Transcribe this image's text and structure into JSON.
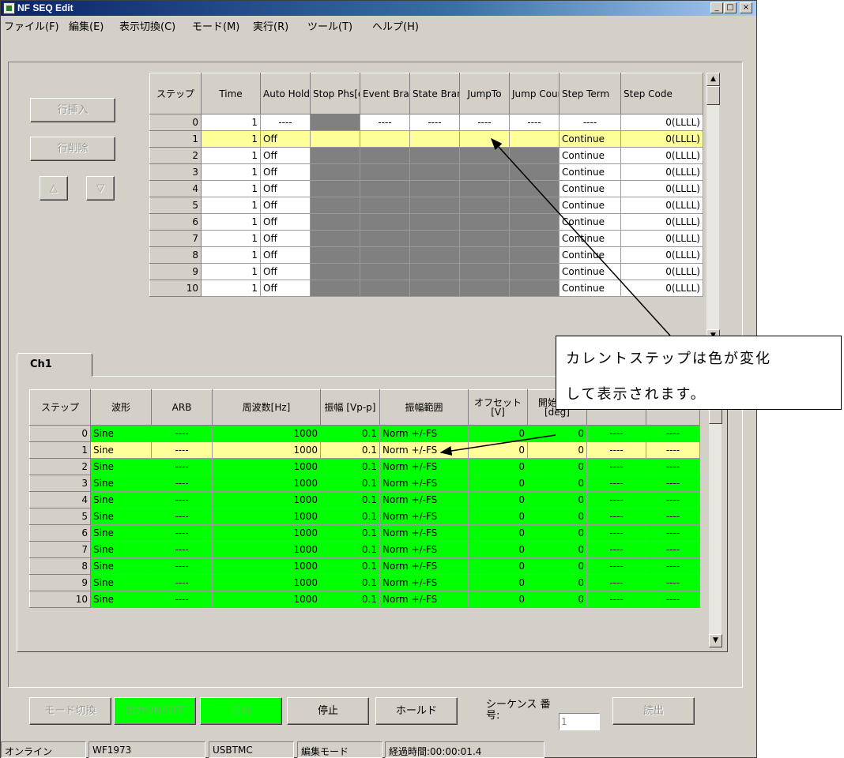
{
  "window": {
    "title": "NF SEQ Edit",
    "min": "_",
    "max": "□",
    "close": "×"
  },
  "menu": [
    "ファイル(F)",
    "編集(E)",
    "表示切換(C)",
    "モード(M)",
    "実行(R)",
    "ツール(T)",
    "ヘルプ(H)"
  ],
  "side_buttons": {
    "insert_row": "行挿入",
    "delete_row": "行削除",
    "up": "△",
    "down": "▽"
  },
  "step_table": {
    "headers": [
      "ステップ",
      "Time",
      "Auto Hold",
      "Stop Phs[deg]",
      "Event Branch",
      "State Branch",
      "JumpTo",
      "Jump Count",
      "Step Term",
      "Step Code"
    ],
    "rows": [
      [
        "0",
        "1",
        "----",
        "",
        "----",
        "----",
        "----",
        "----",
        "----",
        "0(LLLL)"
      ],
      [
        "1",
        "1",
        "Off",
        "",
        "",
        "",
        "",
        "",
        "Continue",
        "0(LLLL)"
      ],
      [
        "2",
        "1",
        "Off",
        "",
        "",
        "",
        "",
        "",
        "Continue",
        "0(LLLL)"
      ],
      [
        "3",
        "1",
        "Off",
        "",
        "",
        "",
        "",
        "",
        "Continue",
        "0(LLLL)"
      ],
      [
        "4",
        "1",
        "Off",
        "",
        "",
        "",
        "",
        "",
        "Continue",
        "0(LLLL)"
      ],
      [
        "5",
        "1",
        "Off",
        "",
        "",
        "",
        "",
        "",
        "Continue",
        "0(LLLL)"
      ],
      [
        "6",
        "1",
        "Off",
        "",
        "",
        "",
        "",
        "",
        "Continue",
        "0(LLLL)"
      ],
      [
        "7",
        "1",
        "Off",
        "",
        "",
        "",
        "",
        "",
        "Continue",
        "0(LLLL)"
      ],
      [
        "8",
        "1",
        "Off",
        "",
        "",
        "",
        "",
        "",
        "Continue",
        "0(LLLL)"
      ],
      [
        "9",
        "1",
        "Off",
        "",
        "",
        "",
        "",
        "",
        "Continue",
        "0(LLLL)"
      ],
      [
        "10",
        "1",
        "Off",
        "",
        "",
        "",
        "",
        "",
        "Continue",
        "0(LLLL)"
      ]
    ]
  },
  "tab": {
    "label": "Ch1"
  },
  "channel_table": {
    "headers": [
      "ステップ",
      "波形",
      "ARB",
      "周波数[Hz]",
      "振幅 [Vp-p]",
      "振幅範囲",
      "オフセット [V]",
      "開始位相 [deg]",
      "",
      ""
    ],
    "rows": [
      [
        "0",
        "Sine",
        "----",
        "1000",
        "0.1",
        "Norm +/-FS",
        "0",
        "0",
        "----",
        "----"
      ],
      [
        "1",
        "Sine",
        "----",
        "1000",
        "0.1",
        "Norm +/-FS",
        "0",
        "0",
        "----",
        "----"
      ],
      [
        "2",
        "Sine",
        "----",
        "1000",
        "0.1",
        "Norm +/-FS",
        "0",
        "0",
        "----",
        "----"
      ],
      [
        "3",
        "Sine",
        "----",
        "1000",
        "0.1",
        "Norm +/-FS",
        "0",
        "0",
        "----",
        "----"
      ],
      [
        "4",
        "Sine",
        "----",
        "1000",
        "0.1",
        "Norm +/-FS",
        "0",
        "0",
        "----",
        "----"
      ],
      [
        "5",
        "Sine",
        "----",
        "1000",
        "0.1",
        "Norm +/-FS",
        "0",
        "0",
        "----",
        "----"
      ],
      [
        "6",
        "Sine",
        "----",
        "1000",
        "0.1",
        "Norm +/-FS",
        "0",
        "0",
        "----",
        "----"
      ],
      [
        "7",
        "Sine",
        "----",
        "1000",
        "0.1",
        "Norm +/-FS",
        "0",
        "0",
        "----",
        "----"
      ],
      [
        "8",
        "Sine",
        "----",
        "1000",
        "0.1",
        "Norm +/-FS",
        "0",
        "0",
        "----",
        "----"
      ],
      [
        "9",
        "Sine",
        "----",
        "1000",
        "0.1",
        "Norm +/-FS",
        "0",
        "0",
        "----",
        "----"
      ],
      [
        "10",
        "Sine",
        "----",
        "1000",
        "0.1",
        "Norm +/-FS",
        "0",
        "0",
        "----",
        "----"
      ]
    ]
  },
  "current_step": 1,
  "callout": {
    "line1": "カレントステップは色が変化",
    "line2": "して表示されます。"
  },
  "bottom_buttons": {
    "mode": "モード切換",
    "output": "出力ON/OFF",
    "start": "開始",
    "stop": "停止",
    "hold": "ホールド",
    "read": "読出"
  },
  "sequence": {
    "label": "シーケンス 番号:",
    "value": "1"
  },
  "status": [
    "オンライン",
    "WF1973",
    "USBTMC",
    "編集モード",
    "経過時間:00:00:01.4"
  ],
  "colors": {
    "title_bar": "#0a246a",
    "current_row": "#ffff99",
    "active_cell": "#00ff00",
    "inactive_cell": "#808080"
  }
}
